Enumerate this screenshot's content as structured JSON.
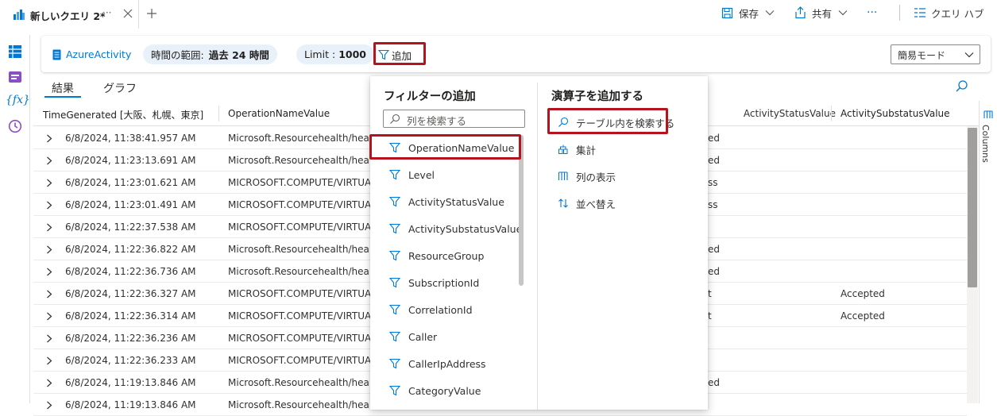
{
  "tab": {
    "title": "新しいクエリ 2*",
    "more": "···"
  },
  "toolbar": {
    "save": "保存",
    "share": "共有",
    "more": "···",
    "hub": "クエリ ハブ"
  },
  "query": {
    "table": "AzureActivity",
    "time_label": "時間の範囲:",
    "time_value": "過去 24 時間",
    "limit_label": "Limit :",
    "limit_value": "1000",
    "add": "追加",
    "mode": "簡易モード"
  },
  "result_tabs": [
    "結果",
    "グラフ"
  ],
  "columns": [
    "TimeGenerated [大阪、札幌、東京]",
    "OperationNameValue",
    "ActivityStatusValue",
    "ActivitySubstatusValue"
  ],
  "columns_label": "Columns",
  "rows": [
    {
      "time": "6/8/2024, 11:38:41.957 AM",
      "op": "Microsoft.Resourcehealth/healthe",
      "status": "ed",
      "sub": ""
    },
    {
      "time": "6/8/2024, 11:23:13.691 AM",
      "op": "Microsoft.Resourcehealth/healthe",
      "status": "ed",
      "sub": ""
    },
    {
      "time": "6/8/2024, 11:23:01.621 AM",
      "op": "MICROSOFT.COMPUTE/VIRTUALM",
      "status": "ss",
      "sub": ""
    },
    {
      "time": "6/8/2024, 11:23:01.491 AM",
      "op": "MICROSOFT.COMPUTE/VIRTUALM",
      "status": "ss",
      "sub": ""
    },
    {
      "time": "6/8/2024, 11:22:37.538 AM",
      "op": "MICROSOFT.COMPUTE/VIRTUALM",
      "status": "",
      "sub": ""
    },
    {
      "time": "6/8/2024, 11:22:36.822 AM",
      "op": "Microsoft.Resourcehealth/healthe",
      "status": "ed",
      "sub": ""
    },
    {
      "time": "6/8/2024, 11:22:36.736 AM",
      "op": "Microsoft.Resourcehealth/healthe",
      "status": "ed",
      "sub": ""
    },
    {
      "time": "6/8/2024, 11:22:36.327 AM",
      "op": "MICROSOFT.COMPUTE/VIRTUALM",
      "status": "t",
      "sub": "Accepted"
    },
    {
      "time": "6/8/2024, 11:22:36.314 AM",
      "op": "MICROSOFT.COMPUTE/VIRTUALM",
      "status": "t",
      "sub": "Accepted"
    },
    {
      "time": "6/8/2024, 11:22:36.236 AM",
      "op": "MICROSOFT.COMPUTE/VIRTUALM",
      "status": "",
      "sub": ""
    },
    {
      "time": "6/8/2024, 11:22:36.233 AM",
      "op": "MICROSOFT.COMPUTE/VIRTUALM",
      "status": "",
      "sub": ""
    },
    {
      "time": "6/8/2024, 11:19:13.846 AM",
      "op": "Microsoft.Resourcehealth/healthe",
      "status": "ed",
      "sub": ""
    },
    {
      "time": "6/8/2024, 11:19:13.846 AM",
      "op": "Microsoft.Resourcehealth/healthe",
      "status": "",
      "sub": ""
    }
  ],
  "filter_panel": {
    "title": "フィルターの追加",
    "search_placeholder": "列を検索する",
    "items": [
      "OperationNameValue",
      "Level",
      "ActivityStatusValue",
      "ActivitySubstatusValue",
      "ResourceGroup",
      "SubscriptionId",
      "CorrelationId",
      "Caller",
      "CallerIpAddress",
      "CategoryValue"
    ]
  },
  "operator_panel": {
    "title": "演算子を追加する",
    "items": [
      "テーブル内を検索する",
      "集計",
      "列の表示",
      "並べ替え"
    ]
  },
  "colors": {
    "accent": "#0078d4",
    "highlight": "#b4141e",
    "pill": "#e8f1fa"
  }
}
